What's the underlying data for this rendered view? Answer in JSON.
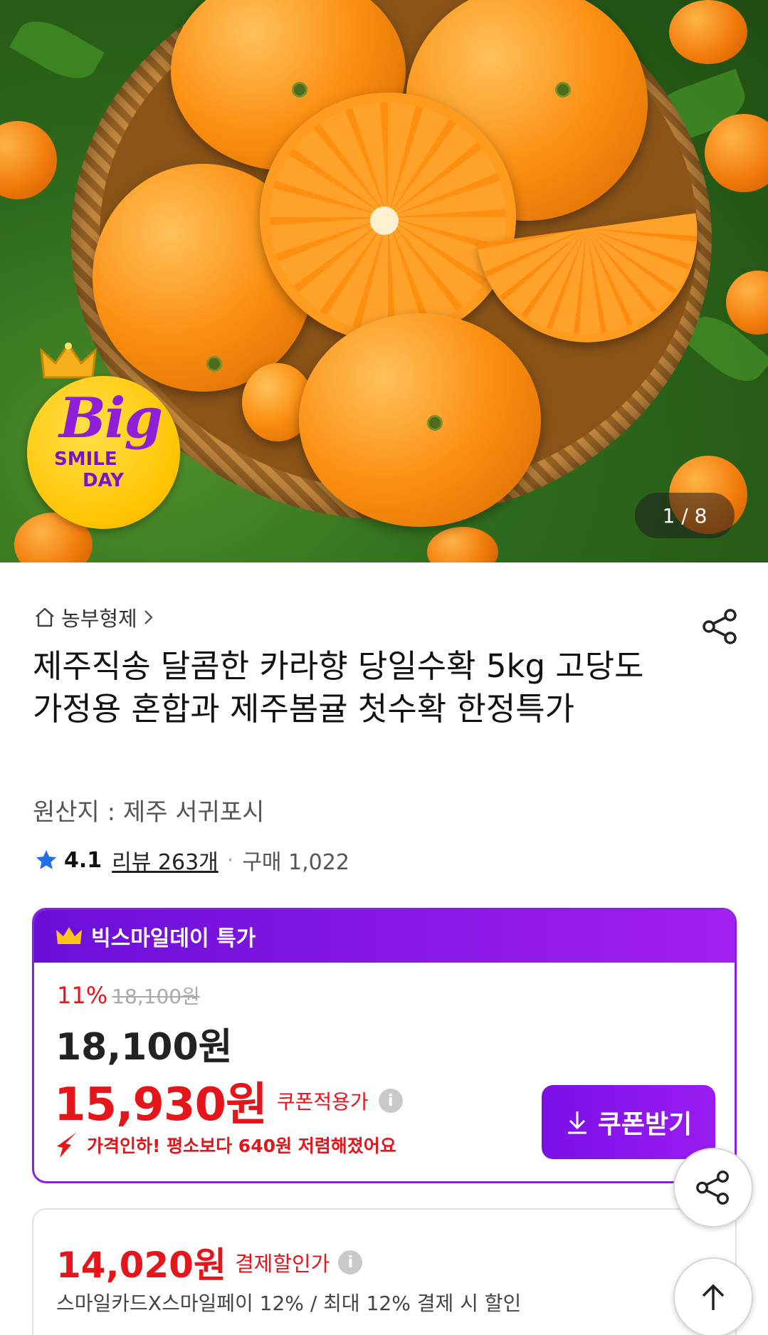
{
  "hero": {
    "badge": {
      "line1": "Big",
      "line2": "SMILE",
      "line3": "DAY"
    },
    "counter": "1 / 8"
  },
  "product": {
    "seller": "농부형제",
    "title": "제주직송 달콤한 카라향 당일수확  5kg 고당도 가정용 혼합과 제주봄귤 첫수확 한정특가",
    "origin": "원산지 : 제주 서귀포시",
    "rating": "4.1",
    "reviews": "리뷰 263개",
    "purchases": "구매 1,022"
  },
  "price_card": {
    "header": "빅스마일데이 특가",
    "discount_percent": "11%",
    "original_price": "18,100원",
    "sale_price": "18,100원",
    "coupon_price": "15,930원",
    "coupon_label": "쿠폰적용가",
    "coupon_button": "쿠폰받기",
    "price_drop_notice": "가격인하! 평소보다 640원 저렴해졌어요"
  },
  "payment_card": {
    "price": "14,020원",
    "label": "결제할인가",
    "description": "스마일카드X스마일페이 12% / 최대 12% 결제 시 할인"
  },
  "colors": {
    "accent_purple": "#8b1ee6",
    "price_red": "#e4151b",
    "star_blue": "#1f6fe5"
  },
  "icons": [
    "home-icon",
    "chevron-right-icon",
    "share-icon",
    "star-icon",
    "crown-icon",
    "info-icon",
    "download-icon",
    "price-drop-arrow-icon",
    "arrow-up-icon"
  ]
}
